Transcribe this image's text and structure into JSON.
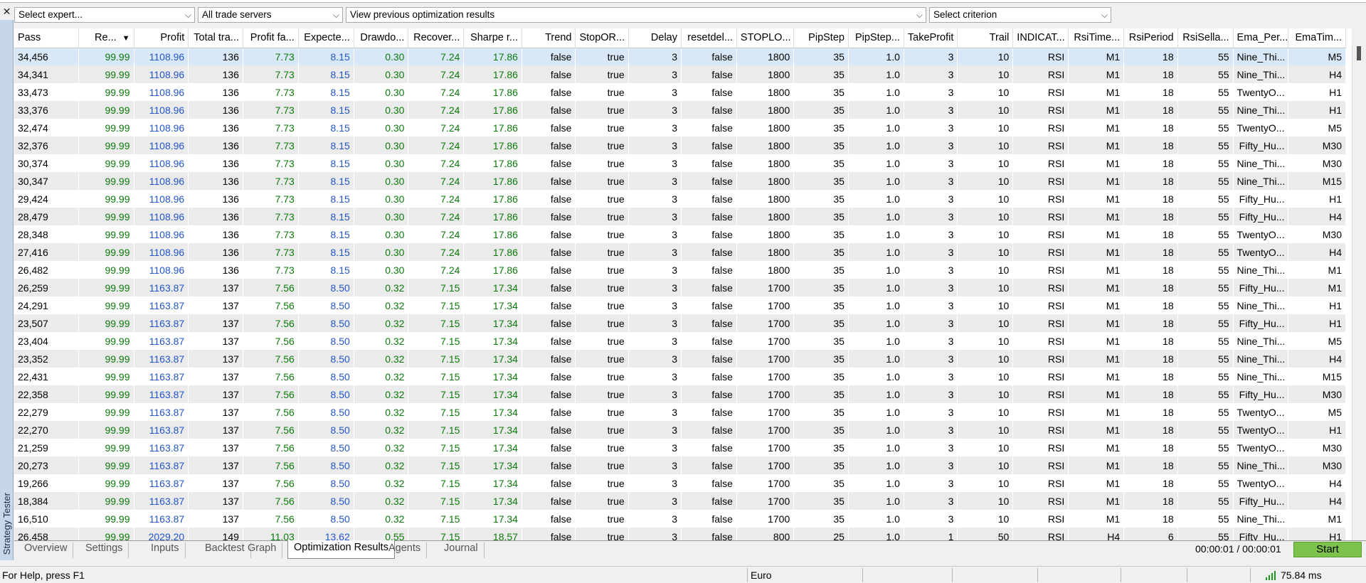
{
  "window": {
    "close_glyph": "✕",
    "side_tab_label": "Strategy Tester"
  },
  "toolbar": {
    "expert_select": "Select expert...",
    "server_select": "All trade servers",
    "results_select": "View previous optimization results",
    "criterion_select": "Select criterion"
  },
  "table": {
    "columns": [
      "Pass",
      "Re...",
      "Profit",
      "Total tra...",
      "Profit fa...",
      "Expecte...",
      "Drawdo...",
      "Recover...",
      "Sharpe r...",
      "Trend",
      "StopOR...",
      "Delay",
      "resetdel...",
      "STOPLO...",
      "PipStep",
      "PipStep...",
      "TakeProfit",
      "Trail",
      "INDICAT...",
      "RsiTime...",
      "RsiPeriod",
      "RsiSella...",
      "Ema_Per...",
      "EmaTim..."
    ],
    "rows": [
      [
        "34,456",
        "99.99",
        "1108.96",
        "136",
        "7.73",
        "8.15",
        "0.30",
        "7.24",
        "17.86",
        "false",
        "true",
        "3",
        "false",
        "1800",
        "35",
        "1.0",
        "3",
        "10",
        "RSI",
        "M1",
        "18",
        "55",
        "Nine_Thi...",
        "M5"
      ],
      [
        "34,341",
        "99.99",
        "1108.96",
        "136",
        "7.73",
        "8.15",
        "0.30",
        "7.24",
        "17.86",
        "false",
        "true",
        "3",
        "false",
        "1800",
        "35",
        "1.0",
        "3",
        "10",
        "RSI",
        "M1",
        "18",
        "55",
        "Nine_Thi...",
        "H4"
      ],
      [
        "33,473",
        "99.99",
        "1108.96",
        "136",
        "7.73",
        "8.15",
        "0.30",
        "7.24",
        "17.86",
        "false",
        "true",
        "3",
        "false",
        "1800",
        "35",
        "1.0",
        "3",
        "10",
        "RSI",
        "M1",
        "18",
        "55",
        "TwentyO...",
        "H1"
      ],
      [
        "33,376",
        "99.99",
        "1108.96",
        "136",
        "7.73",
        "8.15",
        "0.30",
        "7.24",
        "17.86",
        "false",
        "true",
        "3",
        "false",
        "1800",
        "35",
        "1.0",
        "3",
        "10",
        "RSI",
        "M1",
        "18",
        "55",
        "Nine_Thi...",
        "H1"
      ],
      [
        "32,474",
        "99.99",
        "1108.96",
        "136",
        "7.73",
        "8.15",
        "0.30",
        "7.24",
        "17.86",
        "false",
        "true",
        "3",
        "false",
        "1800",
        "35",
        "1.0",
        "3",
        "10",
        "RSI",
        "M1",
        "18",
        "55",
        "TwentyO...",
        "M5"
      ],
      [
        "32,376",
        "99.99",
        "1108.96",
        "136",
        "7.73",
        "8.15",
        "0.30",
        "7.24",
        "17.86",
        "false",
        "true",
        "3",
        "false",
        "1800",
        "35",
        "1.0",
        "3",
        "10",
        "RSI",
        "M1",
        "18",
        "55",
        "Fifty_Hu...",
        "M30"
      ],
      [
        "30,374",
        "99.99",
        "1108.96",
        "136",
        "7.73",
        "8.15",
        "0.30",
        "7.24",
        "17.86",
        "false",
        "true",
        "3",
        "false",
        "1800",
        "35",
        "1.0",
        "3",
        "10",
        "RSI",
        "M1",
        "18",
        "55",
        "Nine_Thi...",
        "M30"
      ],
      [
        "30,347",
        "99.99",
        "1108.96",
        "136",
        "7.73",
        "8.15",
        "0.30",
        "7.24",
        "17.86",
        "false",
        "true",
        "3",
        "false",
        "1800",
        "35",
        "1.0",
        "3",
        "10",
        "RSI",
        "M1",
        "18",
        "55",
        "Nine_Thi...",
        "M15"
      ],
      [
        "29,424",
        "99.99",
        "1108.96",
        "136",
        "7.73",
        "8.15",
        "0.30",
        "7.24",
        "17.86",
        "false",
        "true",
        "3",
        "false",
        "1800",
        "35",
        "1.0",
        "3",
        "10",
        "RSI",
        "M1",
        "18",
        "55",
        "Fifty_Hu...",
        "H1"
      ],
      [
        "28,479",
        "99.99",
        "1108.96",
        "136",
        "7.73",
        "8.15",
        "0.30",
        "7.24",
        "17.86",
        "false",
        "true",
        "3",
        "false",
        "1800",
        "35",
        "1.0",
        "3",
        "10",
        "RSI",
        "M1",
        "18",
        "55",
        "Fifty_Hu...",
        "H4"
      ],
      [
        "28,348",
        "99.99",
        "1108.96",
        "136",
        "7.73",
        "8.15",
        "0.30",
        "7.24",
        "17.86",
        "false",
        "true",
        "3",
        "false",
        "1800",
        "35",
        "1.0",
        "3",
        "10",
        "RSI",
        "M1",
        "18",
        "55",
        "TwentyO...",
        "M30"
      ],
      [
        "27,416",
        "99.99",
        "1108.96",
        "136",
        "7.73",
        "8.15",
        "0.30",
        "7.24",
        "17.86",
        "false",
        "true",
        "3",
        "false",
        "1800",
        "35",
        "1.0",
        "3",
        "10",
        "RSI",
        "M1",
        "18",
        "55",
        "TwentyO...",
        "H4"
      ],
      [
        "26,482",
        "99.99",
        "1108.96",
        "136",
        "7.73",
        "8.15",
        "0.30",
        "7.24",
        "17.86",
        "false",
        "true",
        "3",
        "false",
        "1800",
        "35",
        "1.0",
        "3",
        "10",
        "RSI",
        "M1",
        "18",
        "55",
        "Nine_Thi...",
        "M1"
      ],
      [
        "26,259",
        "99.99",
        "1163.87",
        "137",
        "7.56",
        "8.50",
        "0.32",
        "7.15",
        "17.34",
        "false",
        "true",
        "3",
        "false",
        "1700",
        "35",
        "1.0",
        "3",
        "10",
        "RSI",
        "M1",
        "18",
        "55",
        "Fifty_Hu...",
        "M1"
      ],
      [
        "24,291",
        "99.99",
        "1163.87",
        "137",
        "7.56",
        "8.50",
        "0.32",
        "7.15",
        "17.34",
        "false",
        "true",
        "3",
        "false",
        "1700",
        "35",
        "1.0",
        "3",
        "10",
        "RSI",
        "M1",
        "18",
        "55",
        "Nine_Thi...",
        "H1"
      ],
      [
        "23,507",
        "99.99",
        "1163.87",
        "137",
        "7.56",
        "8.50",
        "0.32",
        "7.15",
        "17.34",
        "false",
        "true",
        "3",
        "false",
        "1700",
        "35",
        "1.0",
        "3",
        "10",
        "RSI",
        "M1",
        "18",
        "55",
        "Fifty_Hu...",
        "H1"
      ],
      [
        "23,404",
        "99.99",
        "1163.87",
        "137",
        "7.56",
        "8.50",
        "0.32",
        "7.15",
        "17.34",
        "false",
        "true",
        "3",
        "false",
        "1700",
        "35",
        "1.0",
        "3",
        "10",
        "RSI",
        "M1",
        "18",
        "55",
        "Nine_Thi...",
        "M5"
      ],
      [
        "23,352",
        "99.99",
        "1163.87",
        "137",
        "7.56",
        "8.50",
        "0.32",
        "7.15",
        "17.34",
        "false",
        "true",
        "3",
        "false",
        "1700",
        "35",
        "1.0",
        "3",
        "10",
        "RSI",
        "M1",
        "18",
        "55",
        "Nine_Thi...",
        "H4"
      ],
      [
        "22,431",
        "99.99",
        "1163.87",
        "137",
        "7.56",
        "8.50",
        "0.32",
        "7.15",
        "17.34",
        "false",
        "true",
        "3",
        "false",
        "1700",
        "35",
        "1.0",
        "3",
        "10",
        "RSI",
        "M1",
        "18",
        "55",
        "Nine_Thi...",
        "M15"
      ],
      [
        "22,358",
        "99.99",
        "1163.87",
        "137",
        "7.56",
        "8.50",
        "0.32",
        "7.15",
        "17.34",
        "false",
        "true",
        "3",
        "false",
        "1700",
        "35",
        "1.0",
        "3",
        "10",
        "RSI",
        "M1",
        "18",
        "55",
        "Fifty_Hu...",
        "M30"
      ],
      [
        "22,279",
        "99.99",
        "1163.87",
        "137",
        "7.56",
        "8.50",
        "0.32",
        "7.15",
        "17.34",
        "false",
        "true",
        "3",
        "false",
        "1700",
        "35",
        "1.0",
        "3",
        "10",
        "RSI",
        "M1",
        "18",
        "55",
        "TwentyO...",
        "M5"
      ],
      [
        "22,270",
        "99.99",
        "1163.87",
        "137",
        "7.56",
        "8.50",
        "0.32",
        "7.15",
        "17.34",
        "false",
        "true",
        "3",
        "false",
        "1700",
        "35",
        "1.0",
        "3",
        "10",
        "RSI",
        "M1",
        "18",
        "55",
        "TwentyO...",
        "H1"
      ],
      [
        "21,259",
        "99.99",
        "1163.87",
        "137",
        "7.56",
        "8.50",
        "0.32",
        "7.15",
        "17.34",
        "false",
        "true",
        "3",
        "false",
        "1700",
        "35",
        "1.0",
        "3",
        "10",
        "RSI",
        "M1",
        "18",
        "55",
        "TwentyO...",
        "M30"
      ],
      [
        "20,273",
        "99.99",
        "1163.87",
        "137",
        "7.56",
        "8.50",
        "0.32",
        "7.15",
        "17.34",
        "false",
        "true",
        "3",
        "false",
        "1700",
        "35",
        "1.0",
        "3",
        "10",
        "RSI",
        "M1",
        "18",
        "55",
        "Nine_Thi...",
        "M30"
      ],
      [
        "19,266",
        "99.99",
        "1163.87",
        "137",
        "7.56",
        "8.50",
        "0.32",
        "7.15",
        "17.34",
        "false",
        "true",
        "3",
        "false",
        "1700",
        "35",
        "1.0",
        "3",
        "10",
        "RSI",
        "M1",
        "18",
        "55",
        "TwentyO...",
        "H4"
      ],
      [
        "18,384",
        "99.99",
        "1163.87",
        "137",
        "7.56",
        "8.50",
        "0.32",
        "7.15",
        "17.34",
        "false",
        "true",
        "3",
        "false",
        "1700",
        "35",
        "1.0",
        "3",
        "10",
        "RSI",
        "M1",
        "18",
        "55",
        "Fifty_Hu...",
        "H4"
      ],
      [
        "16,510",
        "99.99",
        "1163.87",
        "137",
        "7.56",
        "8.50",
        "0.32",
        "7.15",
        "17.34",
        "false",
        "true",
        "3",
        "false",
        "1700",
        "35",
        "1.0",
        "3",
        "10",
        "RSI",
        "M1",
        "18",
        "55",
        "Nine_Thi...",
        "M1"
      ],
      [
        "26,458",
        "99.99",
        "2029.20",
        "149",
        "11.03",
        "13.62",
        "0.55",
        "7.15",
        "18.57",
        "false",
        "true",
        "3",
        "false",
        "800",
        "25",
        "1.0",
        "1",
        "50",
        "RSI",
        "H4",
        "6",
        "55",
        "Fifty_Hu...",
        "H1"
      ]
    ],
    "selected_row": 0,
    "sort_column": "Re...",
    "colors": {
      "green": "#0a7a0a",
      "blue": "#2255cc",
      "selection": "#d9e8f7"
    }
  },
  "tabs": [
    "Overview",
    "Settings",
    "Inputs",
    "Backtest",
    "Graph",
    "Optimization Results",
    "Agents",
    "Journal"
  ],
  "active_tab": "Optimization Results",
  "timer": "00:00:01 / 00:00:01",
  "start_button": "Start",
  "status": {
    "help": "For Help, press F1",
    "currency": "Euro",
    "ping": "75.84 ms"
  },
  "icons": {
    "close": "close-icon",
    "sort": "sort-desc-icon",
    "signal": "signal-icon",
    "chevron": "chevron-down-icon"
  }
}
